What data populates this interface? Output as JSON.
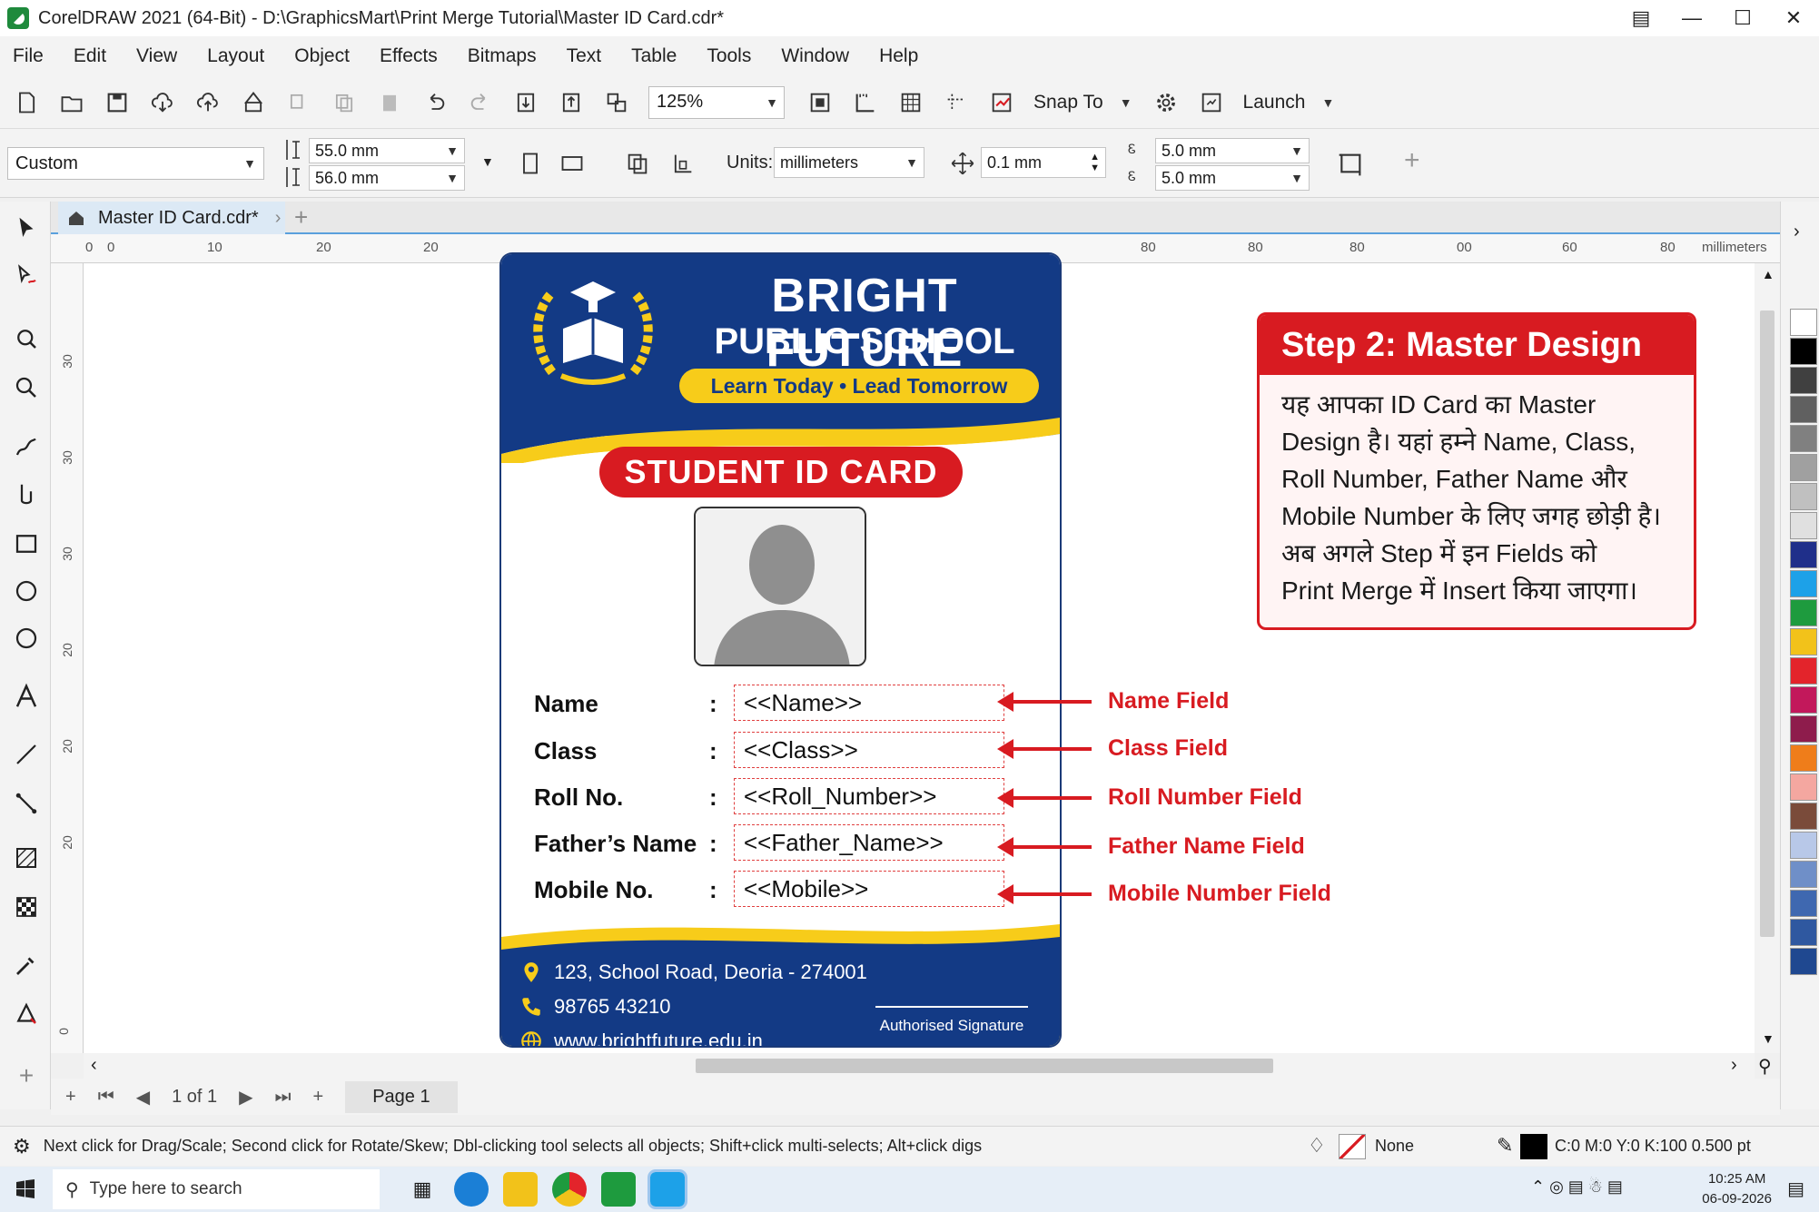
{
  "window": {
    "title": "CorelDRAW 2021 (64-Bit) - D:\\GraphicsMart\\Print Merge Tutorial\\Master ID Card.cdr*"
  },
  "menu": [
    "File",
    "Edit",
    "View",
    "Layout",
    "Object",
    "Effects",
    "Bitmaps",
    "Text",
    "Table",
    "Tools",
    "Window",
    "Help"
  ],
  "toolbar": {
    "zoom": "125%",
    "snap_label": "Snap To",
    "launch_label": "Launch"
  },
  "propbar": {
    "preset": "Custom",
    "width": "55.0 mm",
    "height": "56.0 mm",
    "units_label": "Units:",
    "units_value": "millimeters",
    "nudge": "0.1 mm",
    "dup_x": "5.0 mm",
    "dup_y": "5.0 mm"
  },
  "doc_tab": "Master ID Card.cdr*",
  "ruler": {
    "h_ticks": [
      "0",
      "0",
      "10",
      "20",
      "20",
      "80",
      "80",
      "80",
      "00",
      "60",
      "80",
      "millimeters"
    ],
    "v_ticks": [
      "30",
      "30",
      "30",
      "20",
      "20",
      "20",
      "0"
    ]
  },
  "card": {
    "school_line1": "BRIGHT FUTURE",
    "school_line2": "PUBLIC SCHOOL",
    "tagline": "Learn Today • Lead Tomorrow",
    "badge": "STUDENT ID CARD",
    "fields": [
      {
        "label": "Name",
        "placeholder": "<<Name>>",
        "annotation": "Name Field"
      },
      {
        "label": "Class",
        "placeholder": "<<Class>>",
        "annotation": "Class Field"
      },
      {
        "label": "Roll No.",
        "placeholder": "<<Roll_Number>>",
        "annotation": "Roll Number Field"
      },
      {
        "label": "Father’s Name",
        "placeholder": "<<Father_Name>>",
        "annotation": "Father Name Field"
      },
      {
        "label": "Mobile No.",
        "placeholder": "<<Mobile>>",
        "annotation": "Mobile Number Field"
      }
    ],
    "colon": ":",
    "address": "123, School Road, Deoria - 274001",
    "phone": "98765 43210",
    "website": "www.brightfuture.edu.in",
    "signature": "Authorised Signature"
  },
  "step_box": {
    "title": "Step 2: Master Design",
    "lines": [
      "यह आपका ID Card का Master",
      "Design है। यहां हम्ने Name, Class,",
      "Roll Number, Father Name और",
      "Mobile Number के लिए जगह छोड़ी है।",
      "अब अगले Step में इन Fields को",
      "Print Merge में Insert किया जाएगा।"
    ]
  },
  "pagenav": {
    "page_count": "1 of 1",
    "page_tab": "Page 1"
  },
  "status": {
    "hint": "Next click for Drag/Scale; Second click for Rotate/Skew; Dbl-clicking tool selects all objects; Shift+click multi-selects; Alt+click digs",
    "fill": "None",
    "outline": "C:0 M:0 Y:0 K:100  0.500 pt"
  },
  "taskbar": {
    "search_placeholder": "Type here to search",
    "time": "10:25 AM",
    "date": "06-09-2026"
  },
  "colors": {
    "card_blue": "#133a85",
    "accent_red": "#d81b21",
    "accent_yellow": "#f7cc1a",
    "palette": [
      "#ffffff",
      "#000000",
      "#404040",
      "#606060",
      "#808080",
      "#a0a0a0",
      "#c0c0c0",
      "#e0e0e0",
      "#1f2f8a",
      "#1da1e8",
      "#1e9b3e",
      "#f2c21a",
      "#e3242b",
      "#c2185b",
      "#8e1c4c",
      "#ef7d1a",
      "#f4a7a0",
      "#7a4b3a",
      "#b8c8e8",
      "#6f8fc8",
      "#3f68b0",
      "#2f58a0",
      "#1f4890"
    ]
  }
}
